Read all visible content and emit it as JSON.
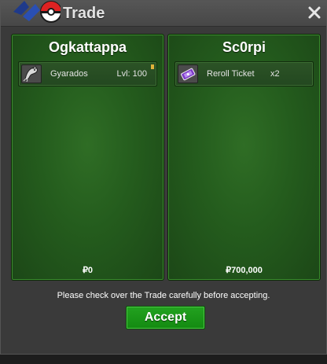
{
  "window": {
    "title": "Trade",
    "logo_icon": "pokeball-logo",
    "close_icon": "close-x"
  },
  "trade": {
    "left": {
      "player": "Ogkattappa",
      "items": [
        {
          "icon": "gyarados-sprite",
          "name": "Gyarados",
          "meta": "Lvl: 100"
        }
      ],
      "money": "₽0"
    },
    "right": {
      "player": "Sc0rpi",
      "items": [
        {
          "icon": "reroll-ticket-icon",
          "name": "Reroll Ticket",
          "meta": "x2"
        }
      ],
      "money": "₽700,000"
    }
  },
  "notice": "Please check over the Trade carefully before accepting.",
  "accept_label": "Accept",
  "colors": {
    "panel_green": "#245c1d",
    "accept_green": "#1a9a17",
    "titlebar": "#4f4f4f",
    "indicator": "#e0b33a"
  }
}
